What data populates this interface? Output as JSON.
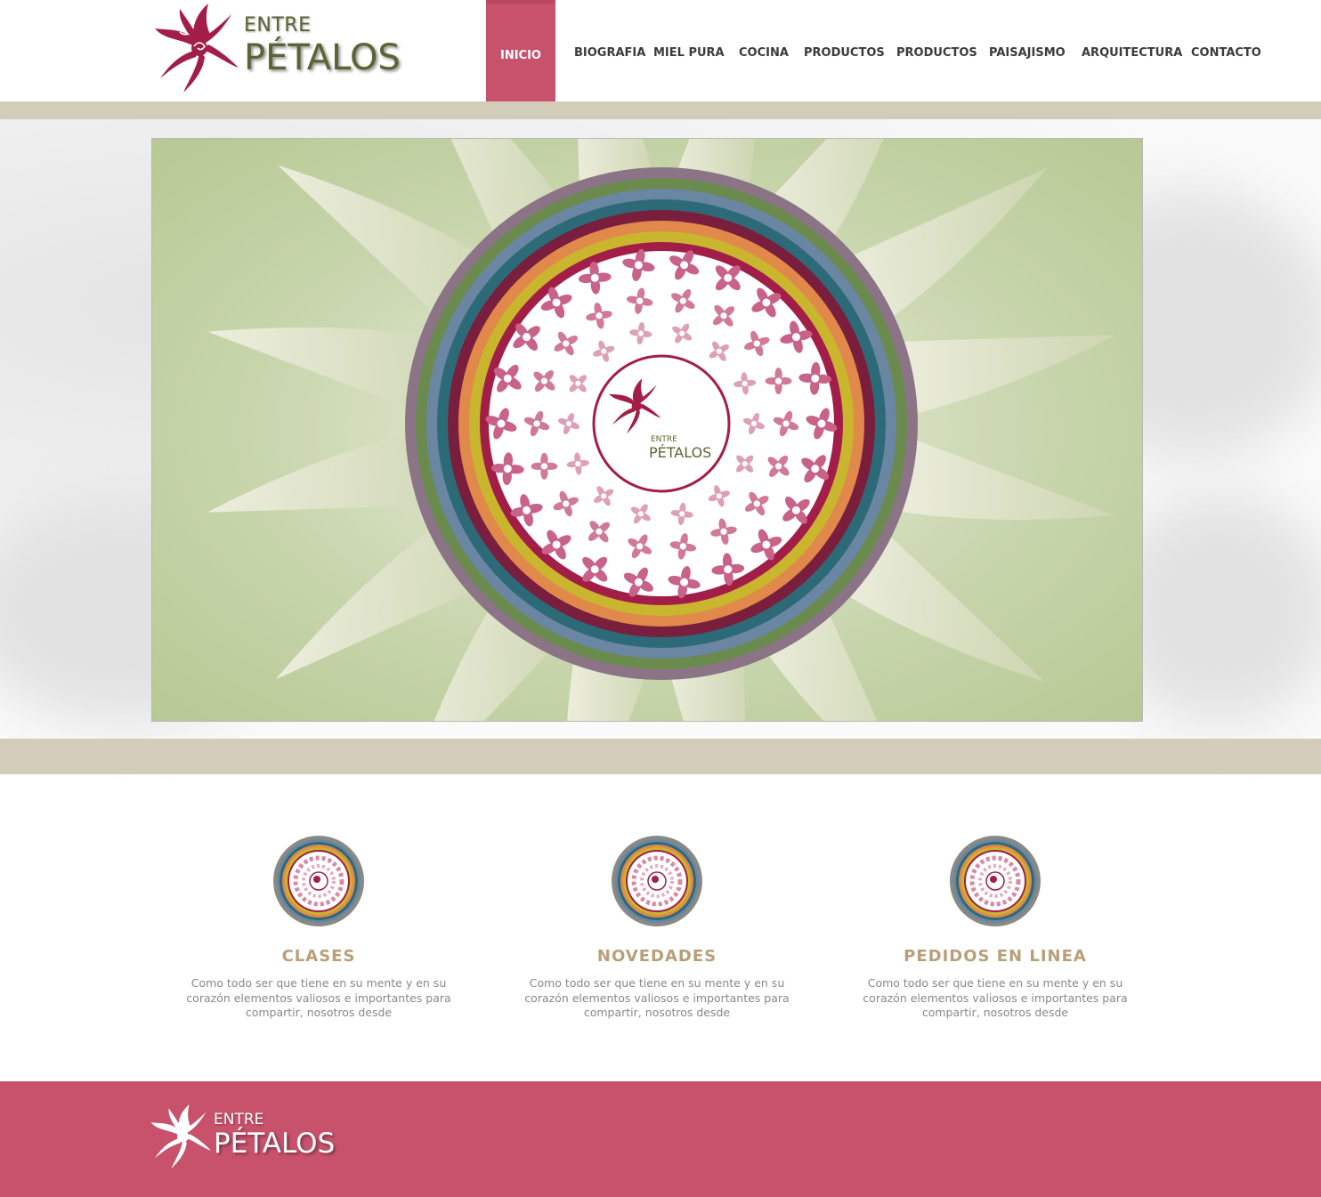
{
  "brand": {
    "line1": "ENTRE",
    "line2": "PÉTALOS",
    "primary_color": "#c8526c",
    "logo_text_color": "#5d6433",
    "flower_color": "#a31d49"
  },
  "nav": {
    "items": [
      {
        "label": "INICIO",
        "active": true
      },
      {
        "label": "BIOGRAFIA"
      },
      {
        "label": "MIEL PURA"
      },
      {
        "label": "COCINA"
      },
      {
        "label": "PRODUCTOS"
      },
      {
        "label": "PRODUCTOS"
      },
      {
        "label": "PAISAJISMO"
      },
      {
        "label": "ARQUITECTURA"
      },
      {
        "label": "CONTACTO"
      }
    ]
  },
  "hero": {
    "badge_line1": "ENTRE",
    "badge_line2": "PÉTALOS",
    "ring_colors": [
      "#8a7486",
      "#6b8a4e",
      "#6a86a3",
      "#2d6a78",
      "#7a1e3e",
      "#e0894a",
      "#c9b62e",
      "#a31d49"
    ]
  },
  "features": [
    {
      "title": "CLASES",
      "text": "Como todo ser que tiene en su mente y en su corazón elementos valiosos e importantes para compartir, nosotros desde"
    },
    {
      "title": "NOVEDADES",
      "text": "Como todo ser que tiene en su mente y en su corazón elementos valiosos e importantes para compartir, nosotros desde"
    },
    {
      "title": "PEDIDOS EN LINEA",
      "text": "Como todo ser que tiene en su mente y en su corazón elementos valiosos e importantes para compartir, nosotros desde"
    }
  ],
  "footer": {
    "line1": "ENTRE",
    "line2": "PÉTALOS"
  },
  "colors": {
    "band": "#d2ccb9",
    "feature_title": "#b89f7a",
    "feature_text": "#888888",
    "nav_text": "#3b3b3b"
  }
}
